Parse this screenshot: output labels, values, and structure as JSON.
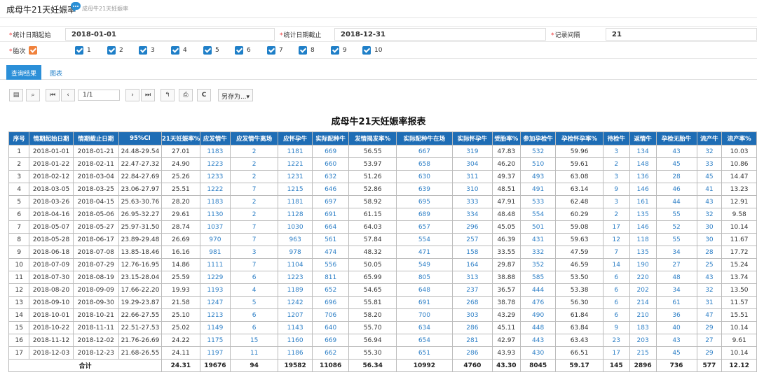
{
  "header": {
    "title": "成母牛21天妊娠率",
    "crumb": "成母牛21天妊娠率"
  },
  "filters": {
    "start_label": "统计日期起始",
    "start_value": "2018-01-01",
    "end_label": "统计日期截止",
    "end_value": "2018-12-31",
    "interval_label": "记录间隔",
    "interval_value": "21",
    "parity_label": "胎次",
    "parity_options": [
      "1",
      "2",
      "3",
      "4",
      "5",
      "6",
      "7",
      "8",
      "9",
      "10"
    ]
  },
  "tabs": {
    "query": "查询结果",
    "chart": "图表"
  },
  "toolbar": {
    "page": "1/1",
    "saveas": "另存为...▾"
  },
  "report": {
    "title": "成母牛21天妊娠率报表",
    "columns": [
      "序号",
      "情期起始日期",
      "情期截止日期",
      "95%CI",
      "21天妊娠率%",
      "应发情牛",
      "应发情牛离场",
      "应怀孕牛",
      "实际配种牛",
      "发情揭发率%",
      "实际配种牛在场",
      "实际怀孕牛",
      "受胎率%",
      "参加孕检牛",
      "孕检怀孕率%",
      "待检牛",
      "返情牛",
      "孕检无胎牛",
      "流产牛",
      "流产率%"
    ],
    "rows": [
      [
        "1",
        "2018-01-01",
        "2018-01-21",
        "24.48-29.54",
        "27.01",
        "1183",
        "2",
        "1181",
        "669",
        "56.55",
        "667",
        "319",
        "47.83",
        "532",
        "59.96",
        "3",
        "134",
        "43",
        "32",
        "10.03"
      ],
      [
        "2",
        "2018-01-22",
        "2018-02-11",
        "22.47-27.32",
        "24.90",
        "1223",
        "2",
        "1221",
        "660",
        "53.97",
        "658",
        "304",
        "46.20",
        "510",
        "59.61",
        "2",
        "148",
        "45",
        "33",
        "10.86"
      ],
      [
        "3",
        "2018-02-12",
        "2018-03-04",
        "22.84-27.69",
        "25.26",
        "1233",
        "2",
        "1231",
        "632",
        "51.26",
        "630",
        "311",
        "49.37",
        "493",
        "63.08",
        "3",
        "136",
        "28",
        "45",
        "14.47"
      ],
      [
        "4",
        "2018-03-05",
        "2018-03-25",
        "23.06-27.97",
        "25.51",
        "1222",
        "7",
        "1215",
        "646",
        "52.86",
        "639",
        "310",
        "48.51",
        "491",
        "63.14",
        "9",
        "146",
        "46",
        "41",
        "13.23"
      ],
      [
        "5",
        "2018-03-26",
        "2018-04-15",
        "25.63-30.76",
        "28.20",
        "1183",
        "2",
        "1181",
        "697",
        "58.92",
        "695",
        "333",
        "47.91",
        "533",
        "62.48",
        "3",
        "161",
        "44",
        "43",
        "12.91"
      ],
      [
        "6",
        "2018-04-16",
        "2018-05-06",
        "26.95-32.27",
        "29.61",
        "1130",
        "2",
        "1128",
        "691",
        "61.15",
        "689",
        "334",
        "48.48",
        "554",
        "60.29",
        "2",
        "135",
        "55",
        "32",
        "9.58"
      ],
      [
        "7",
        "2018-05-07",
        "2018-05-27",
        "25.97-31.50",
        "28.74",
        "1037",
        "7",
        "1030",
        "664",
        "64.03",
        "657",
        "296",
        "45.05",
        "501",
        "59.08",
        "17",
        "146",
        "52",
        "30",
        "10.14"
      ],
      [
        "8",
        "2018-05-28",
        "2018-06-17",
        "23.89-29.48",
        "26.69",
        "970",
        "7",
        "963",
        "561",
        "57.84",
        "554",
        "257",
        "46.39",
        "431",
        "59.63",
        "12",
        "118",
        "55",
        "30",
        "11.67"
      ],
      [
        "9",
        "2018-06-18",
        "2018-07-08",
        "13.85-18.46",
        "16.16",
        "981",
        "3",
        "978",
        "474",
        "48.32",
        "471",
        "158",
        "33.55",
        "332",
        "47.59",
        "7",
        "135",
        "34",
        "28",
        "17.72"
      ],
      [
        "10",
        "2018-07-09",
        "2018-07-29",
        "12.76-16.95",
        "14.86",
        "1111",
        "7",
        "1104",
        "556",
        "50.05",
        "549",
        "164",
        "29.87",
        "352",
        "46.59",
        "14",
        "190",
        "27",
        "25",
        "15.24"
      ],
      [
        "11",
        "2018-07-30",
        "2018-08-19",
        "23.15-28.04",
        "25.59",
        "1229",
        "6",
        "1223",
        "811",
        "65.99",
        "805",
        "313",
        "38.88",
        "585",
        "53.50",
        "6",
        "220",
        "48",
        "43",
        "13.74"
      ],
      [
        "12",
        "2018-08-20",
        "2018-09-09",
        "17.66-22.20",
        "19.93",
        "1193",
        "4",
        "1189",
        "652",
        "54.65",
        "648",
        "237",
        "36.57",
        "444",
        "53.38",
        "6",
        "202",
        "34",
        "32",
        "13.50"
      ],
      [
        "13",
        "2018-09-10",
        "2018-09-30",
        "19.29-23.87",
        "21.58",
        "1247",
        "5",
        "1242",
        "696",
        "55.81",
        "691",
        "268",
        "38.78",
        "476",
        "56.30",
        "6",
        "214",
        "61",
        "31",
        "11.57"
      ],
      [
        "14",
        "2018-10-01",
        "2018-10-21",
        "22.66-27.55",
        "25.10",
        "1213",
        "6",
        "1207",
        "706",
        "58.20",
        "700",
        "303",
        "43.29",
        "490",
        "61.84",
        "6",
        "210",
        "36",
        "47",
        "15.51"
      ],
      [
        "15",
        "2018-10-22",
        "2018-11-11",
        "22.51-27.53",
        "25.02",
        "1149",
        "6",
        "1143",
        "640",
        "55.70",
        "634",
        "286",
        "45.11",
        "448",
        "63.84",
        "9",
        "183",
        "40",
        "29",
        "10.14"
      ],
      [
        "16",
        "2018-11-12",
        "2018-12-02",
        "21.76-26.69",
        "24.22",
        "1175",
        "15",
        "1160",
        "669",
        "56.94",
        "654",
        "281",
        "42.97",
        "443",
        "63.43",
        "23",
        "203",
        "43",
        "27",
        "9.61"
      ],
      [
        "17",
        "2018-12-03",
        "2018-12-23",
        "21.68-26.55",
        "24.11",
        "1197",
        "11",
        "1186",
        "662",
        "55.30",
        "651",
        "286",
        "43.93",
        "430",
        "66.51",
        "17",
        "215",
        "45",
        "29",
        "10.14"
      ]
    ],
    "total": [
      "合计",
      "24.31",
      "19676",
      "94",
      "19582",
      "11086",
      "56.34",
      "10992",
      "4760",
      "43.30",
      "8045",
      "59.17",
      "145",
      "2896",
      "736",
      "577",
      "12.12"
    ]
  },
  "colors": {
    "header_blue": "#1e6db5",
    "link_blue": "#2d7fc6",
    "checkbox_blue": "#1f7fc8",
    "checkbox_orange": "#f0813c"
  }
}
